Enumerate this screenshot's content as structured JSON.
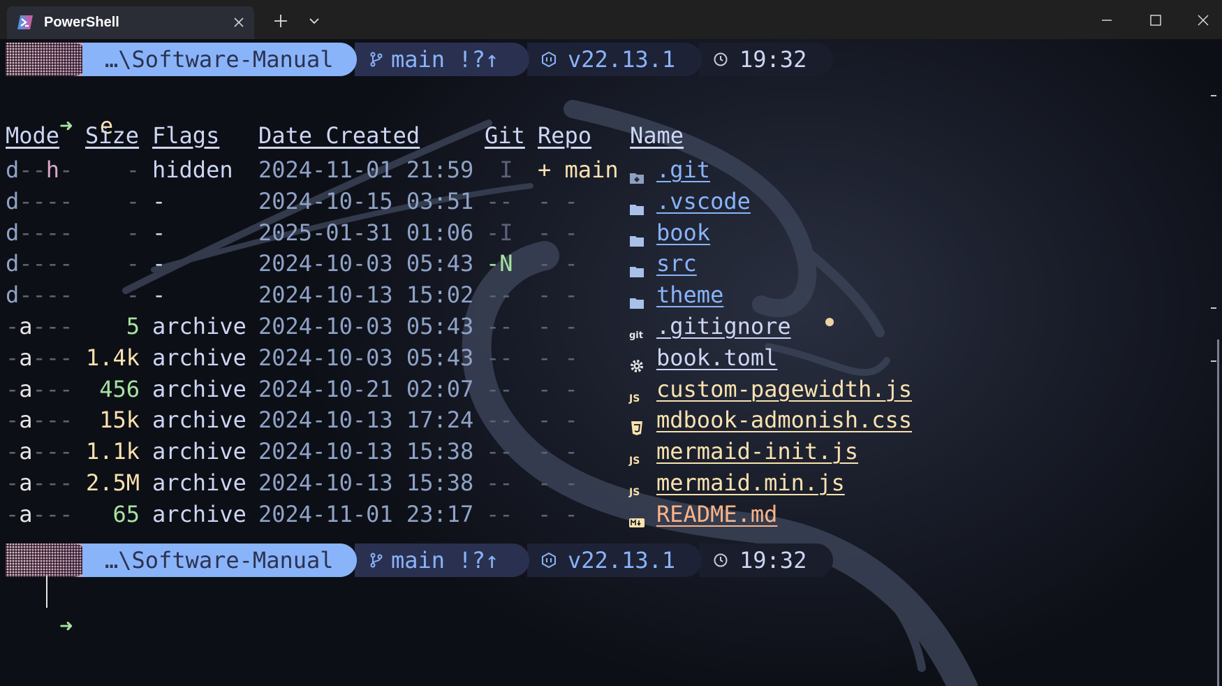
{
  "window": {
    "tab_title": "PowerShell"
  },
  "prompt": {
    "path": "…\\Software-Manual",
    "git": "main !?↑",
    "node": "v22.13.1",
    "time": "19:32"
  },
  "command": {
    "arrow": "➜",
    "text": "e"
  },
  "table": {
    "headers": [
      "Mode",
      "Size",
      "Flags",
      "Date Created",
      "Git",
      "Repo",
      "Name"
    ],
    "rows": [
      {
        "mode": "d--h-",
        "size": "-",
        "flags": "hidden",
        "date": "2024-11-01 21:59",
        "git": " I",
        "repo": "+ main",
        "icon": "git-folder-icon",
        "name": ".git"
      },
      {
        "mode": "d----",
        "size": "-",
        "flags": "-",
        "date": "2024-10-15 03:51",
        "git": "--",
        "repo": "- -",
        "icon": "folder-icon",
        "name": ".vscode"
      },
      {
        "mode": "d----",
        "size": "-",
        "flags": "-",
        "date": "2025-01-31 01:06",
        "git": "-I",
        "repo": "- -",
        "icon": "folder-icon",
        "name": "book"
      },
      {
        "mode": "d----",
        "size": "-",
        "flags": "-",
        "date": "2024-10-03 05:43",
        "git": "-N",
        "repo": "- -",
        "icon": "folder-icon",
        "name": "src"
      },
      {
        "mode": "d----",
        "size": "-",
        "flags": "-",
        "date": "2024-10-13 15:02",
        "git": "--",
        "repo": "- -",
        "icon": "folder-icon",
        "name": "theme"
      },
      {
        "mode": "-a---",
        "size": "5",
        "flags": "archive",
        "date": "2024-10-03 05:43",
        "git": "--",
        "repo": "- -",
        "icon": "git-icon",
        "name": ".gitignore"
      },
      {
        "mode": "-a---",
        "size": "1.4k",
        "flags": "archive",
        "date": "2024-10-03 05:43",
        "git": "--",
        "repo": "- -",
        "icon": "gear-icon",
        "name": "book.toml"
      },
      {
        "mode": "-a---",
        "size": "456",
        "flags": "archive",
        "date": "2024-10-21 02:07",
        "git": "--",
        "repo": "- -",
        "icon": "js-icon",
        "name": "custom-pagewidth.js"
      },
      {
        "mode": "-a---",
        "size": "15k",
        "flags": "archive",
        "date": "2024-10-13 17:24",
        "git": "--",
        "repo": "- -",
        "icon": "css-icon",
        "name": "mdbook-admonish.css"
      },
      {
        "mode": "-a---",
        "size": "1.1k",
        "flags": "archive",
        "date": "2024-10-13 15:38",
        "git": "--",
        "repo": "- -",
        "icon": "js-icon",
        "name": "mermaid-init.js"
      },
      {
        "mode": "-a---",
        "size": "2.5M",
        "flags": "archive",
        "date": "2024-10-13 15:38",
        "git": "--",
        "repo": "- -",
        "icon": "js-icon",
        "name": "mermaid.min.js"
      },
      {
        "mode": "-a---",
        "size": "65",
        "flags": "archive",
        "date": "2024-11-01 23:17",
        "git": "--",
        "repo": "- -",
        "icon": "markdown-icon",
        "name": "README.md"
      }
    ]
  },
  "colors": {
    "path_segment": "#89b4fa",
    "folder_name": "#89b4fa",
    "file_name": "#f9e2af",
    "readme_name": "#fab387",
    "size_small": "#a6e3a1",
    "size_large": "#f9e2af",
    "size_medium": "#cdd6f4"
  }
}
